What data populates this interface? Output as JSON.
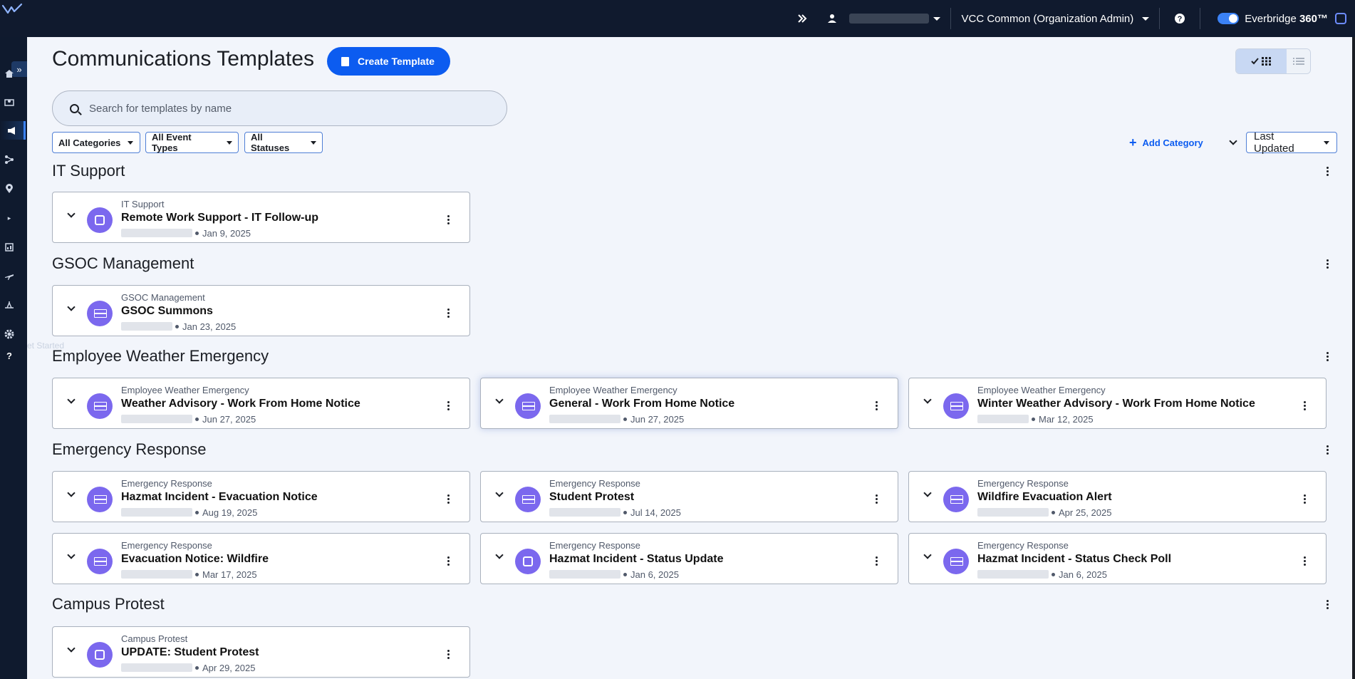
{
  "topbar": {
    "org_label": "VCC Common (Organization Admin)",
    "brand_name": "Everbridge",
    "brand_suffix": "360™"
  },
  "sidebar": {
    "items": [
      "home-icon",
      "map-icon",
      "megaphone-icon",
      "workflow-icon",
      "location-pin-icon",
      "reports-icon",
      "travel-icon",
      "crisis-icon",
      "gear-icon",
      "help-icon"
    ],
    "ghost_text": "et Started"
  },
  "page": {
    "title": "Communications Templates",
    "create_label": "Create Template"
  },
  "search": {
    "placeholder": "Search for templates by name"
  },
  "filters": {
    "categories": "All Categories",
    "event_types": "All Event Types",
    "statuses": "All Statuses"
  },
  "toolbar": {
    "add_category": "Add Category",
    "sort_value": "Last Updated"
  },
  "colors": {
    "accent": "#0c5cf0",
    "avatar": "#7b68ee",
    "topbar": "#101a2e"
  },
  "categories": [
    {
      "name": "IT Support",
      "templates": [
        {
          "category": "IT Support",
          "name": "Remote Work Support - IT Follow-up",
          "date": "Jan 9, 2025",
          "icon": "mail-icon"
        }
      ]
    },
    {
      "name": "GSOC Management",
      "templates": [
        {
          "category": "GSOC Management",
          "name": "GSOC Summons",
          "date": "Jan 23, 2025",
          "icon": "sms-icon"
        }
      ]
    },
    {
      "name": "Employee Weather Emergency",
      "templates": [
        {
          "category": "Employee Weather Emergency",
          "name": "Weather Advisory - Work From Home Notice",
          "date": "Jun 27, 2025",
          "icon": "sms-icon"
        },
        {
          "category": "Employee Weather Emergency",
          "name": "General - Work From Home Notice",
          "date": "Jun 27, 2025",
          "icon": "sms-icon"
        },
        {
          "category": "Employee Weather Emergency",
          "name": "Winter Weather Advisory - Work From Home Notice",
          "date": "Mar 12, 2025",
          "icon": "sms-icon"
        }
      ]
    },
    {
      "name": "Emergency Response",
      "templates": [
        {
          "category": "Emergency Response",
          "name": "Hazmat Incident - Evacuation Notice",
          "date": "Aug 19, 2025",
          "icon": "sms-icon"
        },
        {
          "category": "Emergency Response",
          "name": "Student Protest",
          "date": "Jul 14, 2025",
          "icon": "sms-icon"
        },
        {
          "category": "Emergency Response",
          "name": "Wildfire Evacuation Alert",
          "date": "Apr 25, 2025",
          "icon": "sms-icon"
        },
        {
          "category": "Emergency Response",
          "name": "Evacuation Notice: Wildfire",
          "date": "Mar 17, 2025",
          "icon": "sms-icon"
        },
        {
          "category": "Emergency Response",
          "name": "Hazmat Incident - Status Update",
          "date": "Jan 6, 2025",
          "icon": "mail-icon"
        },
        {
          "category": "Emergency Response",
          "name": "Hazmat Incident - Status Check Poll",
          "date": "Jan 6, 2025",
          "icon": "sms-icon"
        }
      ]
    },
    {
      "name": "Campus Protest",
      "templates": [
        {
          "category": "Campus Protest",
          "name": "UPDATE: Student Protest",
          "date": "Apr 29, 2025",
          "icon": "mail-icon"
        }
      ]
    }
  ]
}
